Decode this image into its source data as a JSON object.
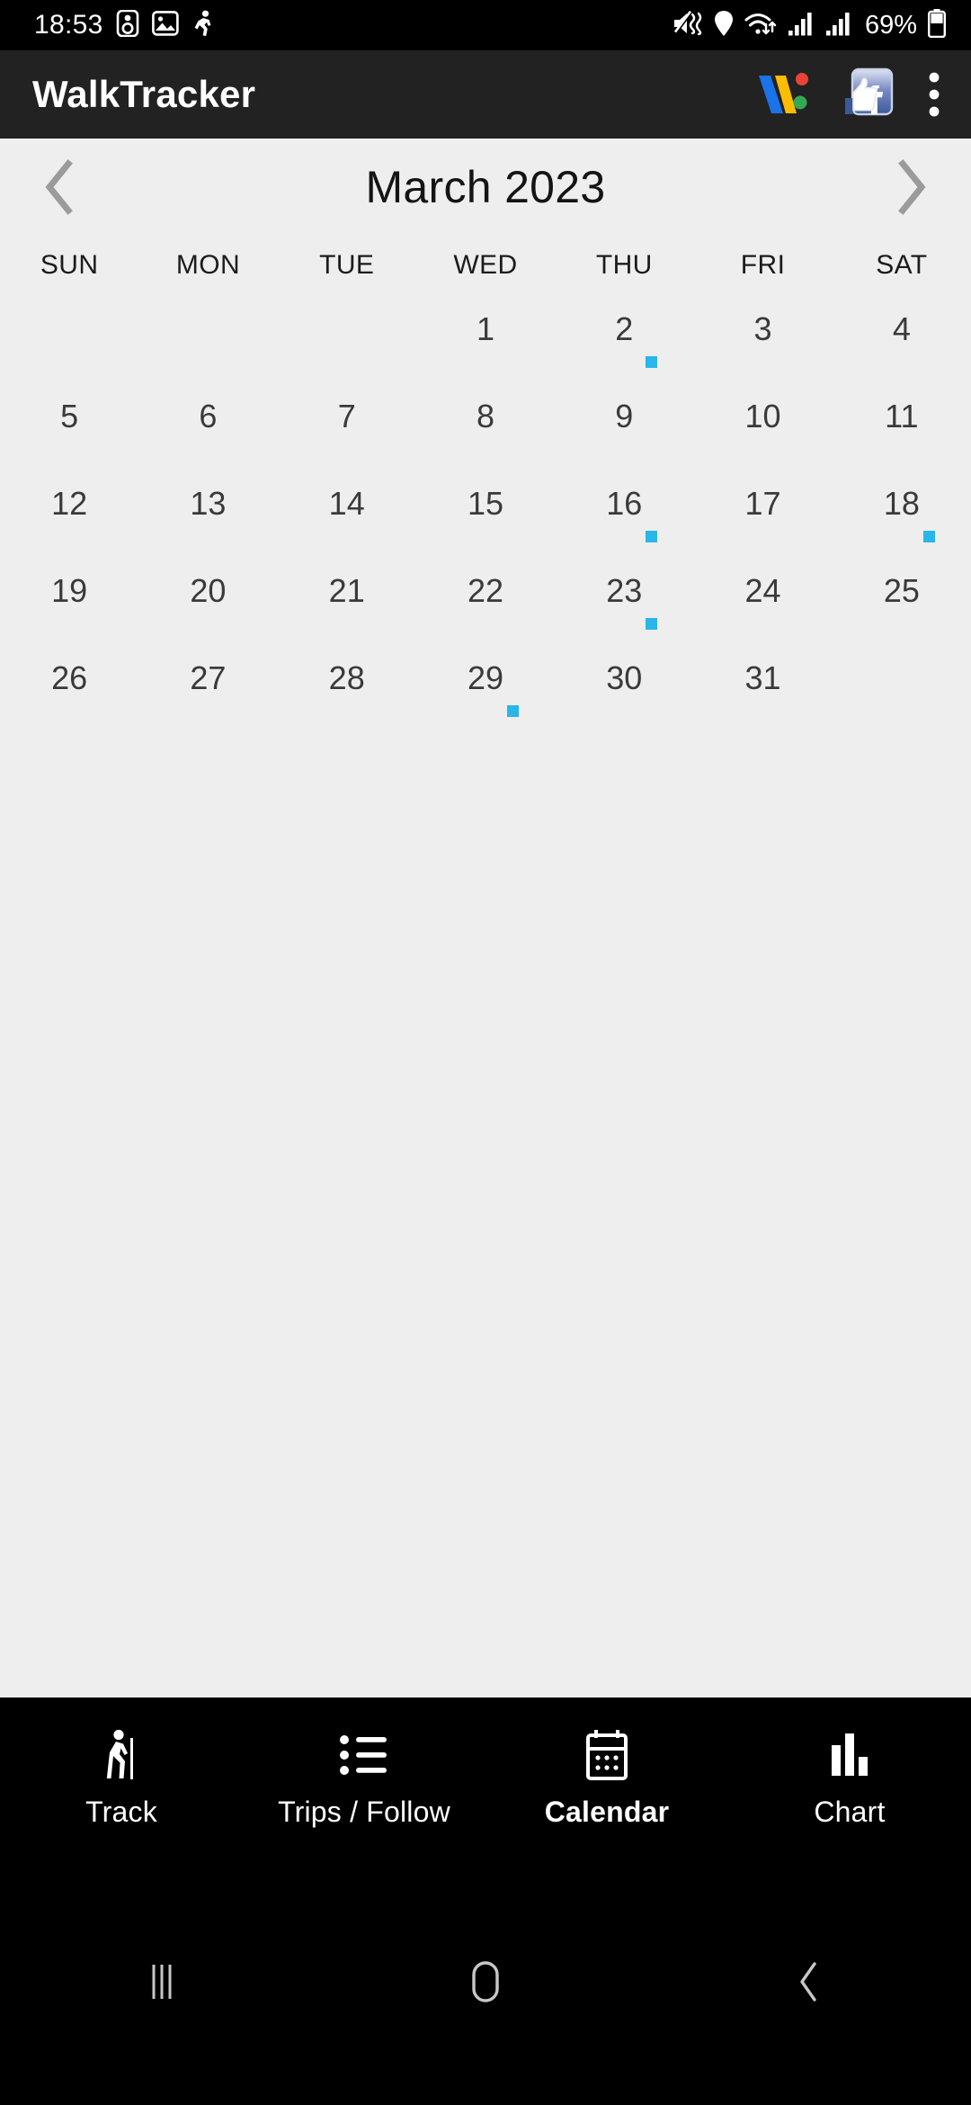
{
  "status_bar": {
    "clock": "18:53",
    "battery_percent": "69%",
    "left_icons": [
      "speaker-icon",
      "image-icon",
      "running-person-icon"
    ],
    "right_icons": [
      "mute-icon",
      "location-icon",
      "wifi-icon",
      "signal-1-icon",
      "signal-2-icon",
      "battery-icon"
    ]
  },
  "app_bar": {
    "title": "WalkTracker",
    "actions": [
      {
        "name": "google-wallet-icon"
      },
      {
        "name": "facebook-icon"
      },
      {
        "name": "overflow-menu-icon"
      }
    ]
  },
  "calendar": {
    "prev_label": "‹",
    "next_label": "›",
    "month_title": "March 2023",
    "weekdays": [
      "SUN",
      "MON",
      "TUE",
      "WED",
      "THU",
      "FRI",
      "SAT"
    ],
    "marker_color": "#29b6e8",
    "weeks": [
      [
        {
          "day": "",
          "marker": false
        },
        {
          "day": "",
          "marker": false
        },
        {
          "day": "",
          "marker": false
        },
        {
          "day": "1",
          "marker": false
        },
        {
          "day": "2",
          "marker": true
        },
        {
          "day": "3",
          "marker": false
        },
        {
          "day": "4",
          "marker": false
        }
      ],
      [
        {
          "day": "5",
          "marker": false
        },
        {
          "day": "6",
          "marker": false
        },
        {
          "day": "7",
          "marker": false
        },
        {
          "day": "8",
          "marker": false
        },
        {
          "day": "9",
          "marker": false
        },
        {
          "day": "10",
          "marker": false
        },
        {
          "day": "11",
          "marker": false
        }
      ],
      [
        {
          "day": "12",
          "marker": false
        },
        {
          "day": "13",
          "marker": false
        },
        {
          "day": "14",
          "marker": false
        },
        {
          "day": "15",
          "marker": false
        },
        {
          "day": "16",
          "marker": true
        },
        {
          "day": "17",
          "marker": false
        },
        {
          "day": "18",
          "marker": true
        }
      ],
      [
        {
          "day": "19",
          "marker": false
        },
        {
          "day": "20",
          "marker": false
        },
        {
          "day": "21",
          "marker": false
        },
        {
          "day": "22",
          "marker": false
        },
        {
          "day": "23",
          "marker": true
        },
        {
          "day": "24",
          "marker": false
        },
        {
          "day": "25",
          "marker": false
        }
      ],
      [
        {
          "day": "26",
          "marker": false
        },
        {
          "day": "27",
          "marker": false
        },
        {
          "day": "28",
          "marker": false
        },
        {
          "day": "29",
          "marker": true
        },
        {
          "day": "30",
          "marker": false
        },
        {
          "day": "31",
          "marker": false
        },
        {
          "day": "",
          "marker": false
        }
      ]
    ]
  },
  "bottom_nav": {
    "items": [
      {
        "label": "Track",
        "icon": "hiker-icon",
        "active": false
      },
      {
        "label": "Trips / Follow",
        "icon": "list-icon",
        "active": false
      },
      {
        "label": "Calendar",
        "icon": "calendar-icon",
        "active": true
      },
      {
        "label": "Chart",
        "icon": "bar-chart-icon",
        "active": false
      }
    ]
  },
  "system_nav": {
    "recents": "recents-icon",
    "home": "home-icon",
    "back": "back-icon"
  }
}
